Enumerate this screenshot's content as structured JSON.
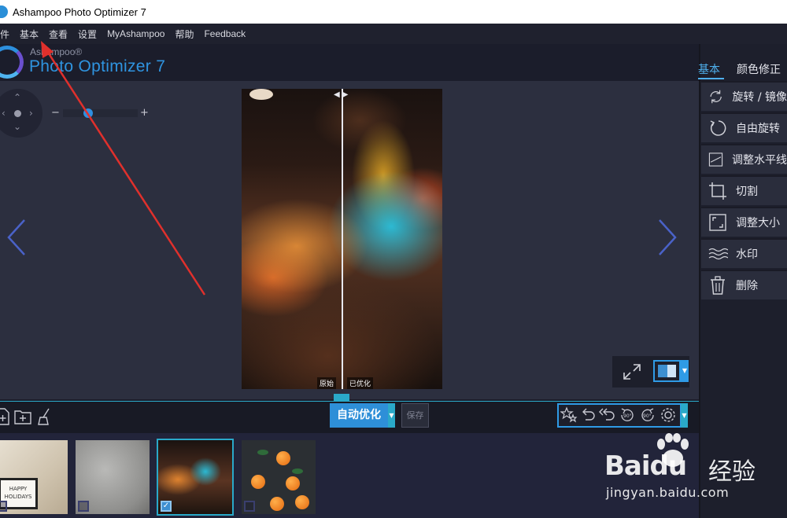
{
  "window": {
    "title": "Ashampoo Photo Optimizer 7"
  },
  "menu": {
    "items": [
      "件",
      "基本",
      "查看",
      "设置",
      "MyAshampoo",
      "帮助",
      "Feedback"
    ]
  },
  "brand": {
    "small": "Ashampoo®",
    "large": "Photo Optimizer 7"
  },
  "zoom": {
    "minus": "−",
    "plus": "+",
    "level": 0.3
  },
  "preview": {
    "original_label": "原始",
    "optimized_label": "已优化",
    "divider_handle": "◀▶"
  },
  "toolbar": {
    "auto_optimize": "自动优化",
    "save": "保存"
  },
  "right_panel": {
    "tabs": [
      {
        "label": "基本",
        "active": true
      },
      {
        "label": "颜色修正",
        "active": false
      }
    ],
    "items": [
      {
        "label": "旋转 / 镜像",
        "icon": "rotate-icon"
      },
      {
        "label": "自由旋转",
        "icon": "free-rotate-icon"
      },
      {
        "label": "调整水平线",
        "icon": "horizon-icon"
      },
      {
        "label": "切割",
        "icon": "crop-icon"
      },
      {
        "label": "调整大小",
        "icon": "resize-icon"
      },
      {
        "label": "水印",
        "icon": "watermark-icon"
      },
      {
        "label": "删除",
        "icon": "trash-icon"
      }
    ]
  },
  "thumbnails": [
    {
      "name": "holiday-card",
      "caption": "HAPPY HOLIDAYS",
      "selected": false
    },
    {
      "name": "gray-texture",
      "selected": false
    },
    {
      "name": "night-street",
      "selected": true,
      "check_mark": "✓"
    },
    {
      "name": "oranges",
      "selected": false
    }
  ],
  "watermark": {
    "baidu_text": "Baidu",
    "jingyan_cn": "经验",
    "url": "jingyan.baidu.com"
  },
  "colors": {
    "accent": "#2f9be6",
    "cyan": "#2aa9c9",
    "bg": "#1b1d2b",
    "panel": "#2a2d3c"
  }
}
